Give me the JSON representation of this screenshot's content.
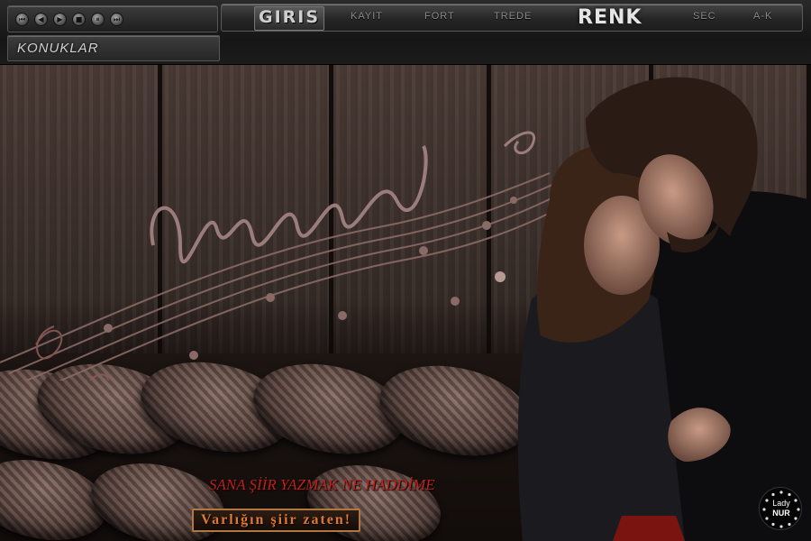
{
  "player": {
    "buttons": [
      "⏮",
      "◀",
      "▶",
      "■",
      "⏸",
      "⏭"
    ]
  },
  "panel": {
    "label": "KONUKLAR"
  },
  "menu": {
    "giris": "GIRIS",
    "items": [
      "KAYIT",
      "FORT",
      "TREDE",
      "RENK",
      "SEC",
      "A-K"
    ]
  },
  "poem": {
    "line1": "SANA ŞİİR YAZMAK NE HADDİME",
    "line2": "Varlığın şiir zaten!"
  },
  "watermark": {
    "line1": "Lady",
    "line2": "NUR"
  },
  "icons": {
    "player": [
      "previous-icon",
      "rewind-icon",
      "play-icon",
      "stop-icon",
      "pause-icon",
      "next-icon"
    ],
    "badge": "stars-ring-icon"
  },
  "colors": {
    "poem_red": "#c0201a",
    "poem_orange": "#e07830",
    "wood": "#3c302b"
  }
}
